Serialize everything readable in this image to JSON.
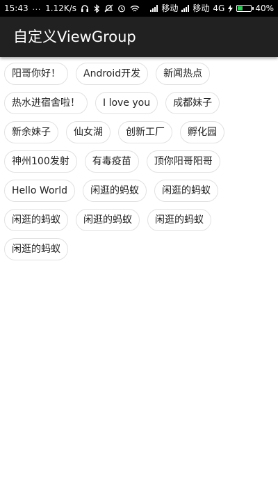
{
  "status_bar": {
    "time": "15:43",
    "dots": "...",
    "net_speed": "1.12K/s",
    "carrier1": "移动",
    "carrier2": "移动",
    "network_type": "4G",
    "battery": "40%",
    "battery_level": 0.4,
    "battery_color": "#34c759",
    "icons": [
      "headphones-icon",
      "bluetooth-icon",
      "mute-icon",
      "alarm-icon",
      "wifi-icon",
      "signal-icon",
      "charging-icon",
      "battery-icon"
    ]
  },
  "app_bar": {
    "title": "自定义ViewGroup",
    "background": "#212121"
  },
  "tags": [
    "阳哥你好！",
    "Android开发",
    "新闻热点",
    "热水进宿舍啦！",
    "I love you",
    "成都妹子",
    "新余妹子",
    "仙女湖",
    "创新工厂",
    "孵化园",
    "神州100发射",
    "有毒疫苗",
    "顶你阳哥阳哥",
    "Hello World",
    "闲逛的蚂蚁",
    "闲逛的蚂蚁",
    "闲逛的蚂蚁",
    "闲逛的蚂蚁",
    "闲逛的蚂蚁",
    "闲逛的蚂蚁"
  ]
}
